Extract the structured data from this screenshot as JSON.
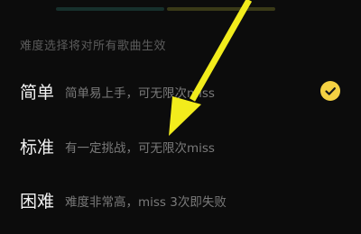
{
  "settings": {
    "hint": "难度选择将对所有歌曲生效",
    "options": [
      {
        "name": "简单",
        "desc": "简单易上手，可无限次miss",
        "selected": true
      },
      {
        "name": "标准",
        "desc": "有一定挑战，可无限次miss",
        "selected": false
      },
      {
        "name": "困难",
        "desc": "难度非常高，miss 3次即失败",
        "selected": false
      }
    ]
  },
  "colors": {
    "accent": "#f5d243",
    "annotation_arrow": "#f2ec1c",
    "background": "#0c0c0c"
  }
}
